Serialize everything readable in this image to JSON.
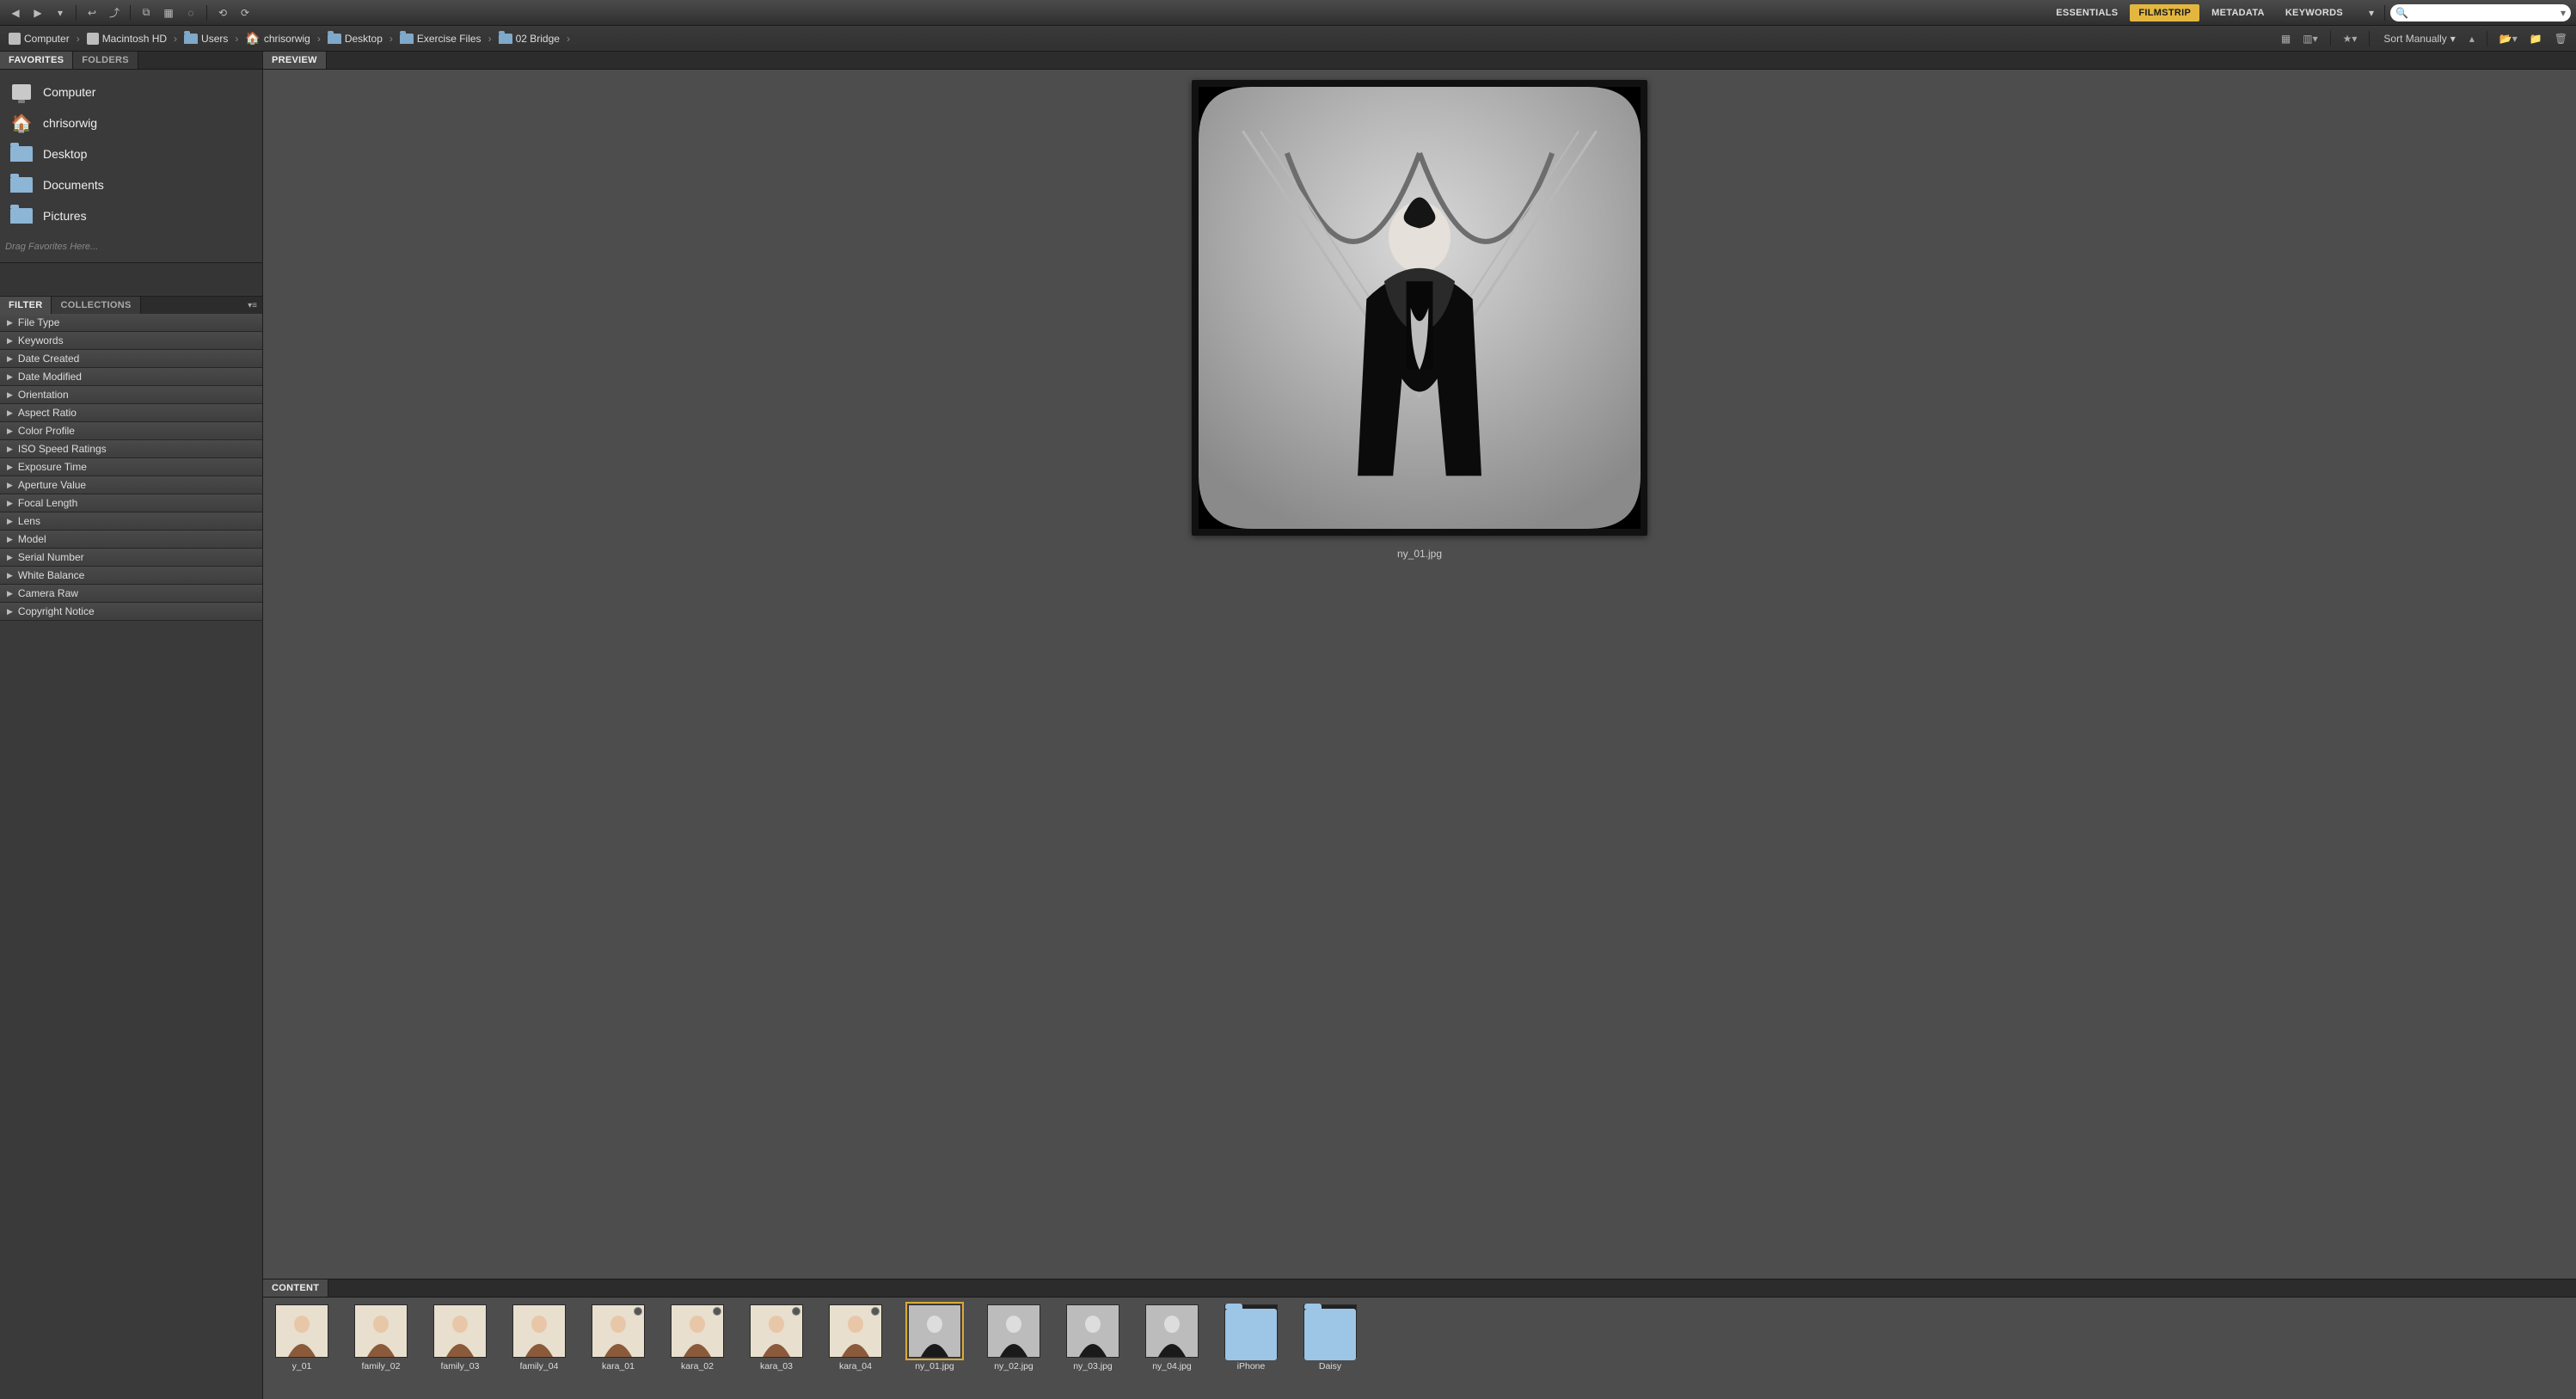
{
  "toolbar": {
    "workspaces": [
      "ESSENTIALS",
      "FILMSTRIP",
      "METADATA",
      "KEYWORDS"
    ],
    "active_workspace": "FILMSTRIP",
    "search_placeholder": ""
  },
  "breadcrumb": [
    {
      "label": "Computer",
      "icon": "drive"
    },
    {
      "label": "Macintosh HD",
      "icon": "drive"
    },
    {
      "label": "Users",
      "icon": "folder"
    },
    {
      "label": "chrisorwig",
      "icon": "home"
    },
    {
      "label": "Desktop",
      "icon": "folder"
    },
    {
      "label": "Exercise Files",
      "icon": "folder"
    },
    {
      "label": "02 Bridge",
      "icon": "folder"
    }
  ],
  "sort_label": "Sort Manually",
  "favorites": {
    "tab_favorites": "FAVORITES",
    "tab_folders": "FOLDERS",
    "items": [
      {
        "label": "Computer",
        "icon": "computer"
      },
      {
        "label": "chrisorwig",
        "icon": "house"
      },
      {
        "label": "Desktop",
        "icon": "folder"
      },
      {
        "label": "Documents",
        "icon": "folder"
      },
      {
        "label": "Pictures",
        "icon": "folder"
      }
    ],
    "hint": "Drag Favorites Here..."
  },
  "filter": {
    "tab_filter": "FILTER",
    "tab_collections": "COLLECTIONS",
    "rows": [
      "File Type",
      "Keywords",
      "Date Created",
      "Date Modified",
      "Orientation",
      "Aspect Ratio",
      "Color Profile",
      "ISO Speed Ratings",
      "Exposure Time",
      "Aperture Value",
      "Focal Length",
      "Lens",
      "Model",
      "Serial Number",
      "White Balance",
      "Camera Raw",
      "Copyright Notice"
    ]
  },
  "preview": {
    "tab": "PREVIEW",
    "filename": "ny_01.jpg"
  },
  "content": {
    "tab": "CONTENT",
    "thumbs": [
      {
        "label": "y_01",
        "kind": "photo",
        "tone": "color"
      },
      {
        "label": "family_02",
        "kind": "photo",
        "tone": "color"
      },
      {
        "label": "family_03",
        "kind": "photo",
        "tone": "color"
      },
      {
        "label": "family_04",
        "kind": "photo",
        "tone": "color"
      },
      {
        "label": "kara_01",
        "kind": "photo",
        "tone": "color",
        "badge": true
      },
      {
        "label": "kara_02",
        "kind": "photo",
        "tone": "color",
        "badge": true
      },
      {
        "label": "kara_03",
        "kind": "photo",
        "tone": "color",
        "badge": true
      },
      {
        "label": "kara_04",
        "kind": "photo",
        "tone": "color",
        "badge": true
      },
      {
        "label": "ny_01.jpg",
        "kind": "photo",
        "tone": "bw",
        "selected": true
      },
      {
        "label": "ny_02.jpg",
        "kind": "photo",
        "tone": "bw"
      },
      {
        "label": "ny_03.jpg",
        "kind": "photo",
        "tone": "bw"
      },
      {
        "label": "ny_04.jpg",
        "kind": "photo",
        "tone": "bw"
      },
      {
        "label": "iPhone",
        "kind": "folder"
      },
      {
        "label": "Daisy",
        "kind": "folder"
      }
    ]
  }
}
